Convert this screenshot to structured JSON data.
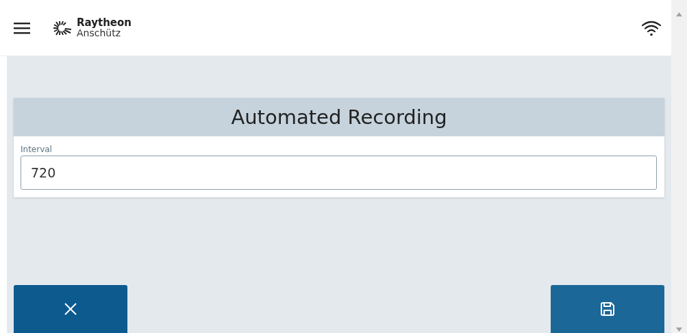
{
  "header": {
    "brand_name": "Raytheon",
    "brand_sub": "Anschütz"
  },
  "card": {
    "title": "Automated Recording",
    "field": {
      "label": "Interval",
      "value": "720"
    }
  },
  "buttons": [
    {
      "kind": "cancel"
    },
    {
      "kind": "save"
    }
  ]
}
